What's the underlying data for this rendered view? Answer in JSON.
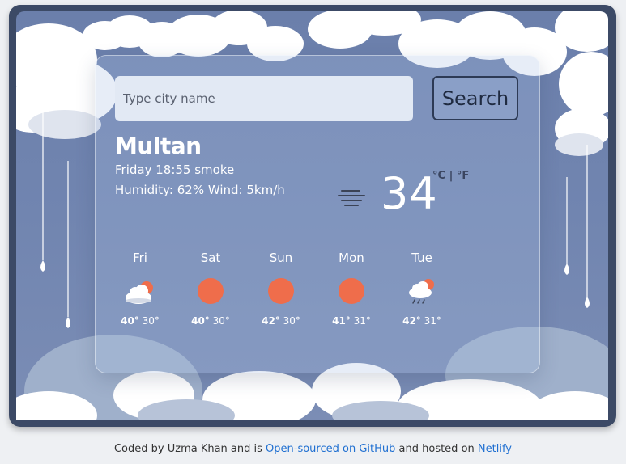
{
  "search": {
    "placeholder": "Type city name",
    "button_label": "Search"
  },
  "current": {
    "city": "Multan",
    "datetime_desc": "Friday 18:55 smoke",
    "details": "Humidity: 62% Wind: 5km/h",
    "temperature": "34",
    "icon": "haze-icon",
    "unit_celsius": "°C",
    "unit_separator": "|",
    "unit_fahrenheit": "°F"
  },
  "forecast": [
    {
      "day": "Fri",
      "icon": "partly-cloudy-icon",
      "max": "40°",
      "min": "30°"
    },
    {
      "day": "Sat",
      "icon": "sun-icon",
      "max": "40°",
      "min": "30°"
    },
    {
      "day": "Sun",
      "icon": "sun-icon",
      "max": "42°",
      "min": "30°"
    },
    {
      "day": "Mon",
      "icon": "sun-icon",
      "max": "41°",
      "min": "31°"
    },
    {
      "day": "Tue",
      "icon": "rain-showers-icon",
      "max": "42°",
      "min": "31°"
    }
  ],
  "footer": {
    "prefix": "Coded by Uzma Khan and is",
    "github_link": "Open-sourced on GitHub",
    "middle": "and hosted on",
    "netlify_link": "Netlify"
  },
  "colors": {
    "sky": "#6b7fab",
    "sun": "#ef6d4b",
    "frame": "#3c4a66"
  }
}
